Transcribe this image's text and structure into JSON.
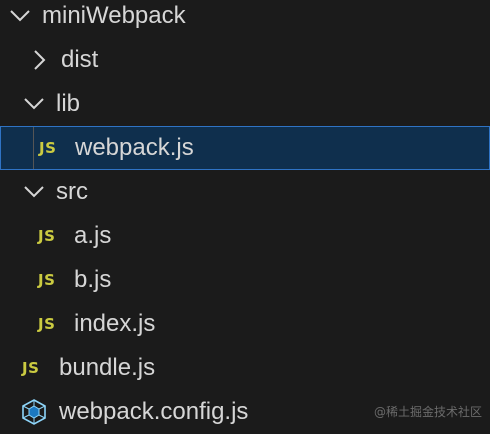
{
  "explorer": {
    "root": {
      "label": "miniWebpack",
      "expanded": true
    },
    "items": [
      {
        "label": "dist",
        "type": "folder",
        "expanded": false
      },
      {
        "label": "lib",
        "type": "folder",
        "expanded": true
      },
      {
        "label": "webpack.js",
        "type": "js",
        "selected": true,
        "icon_text": "JS"
      },
      {
        "label": "src",
        "type": "folder",
        "expanded": true
      },
      {
        "label": "a.js",
        "type": "js",
        "icon_text": "JS"
      },
      {
        "label": "b.js",
        "type": "js",
        "icon_text": "JS"
      },
      {
        "label": "index.js",
        "type": "js",
        "icon_text": "JS"
      },
      {
        "label": "bundle.js",
        "type": "js",
        "icon_text": "JS"
      },
      {
        "label": "webpack.config.js",
        "type": "webpack-config"
      }
    ]
  },
  "watermark": "@稀土掘金技术社区",
  "colors": {
    "background": "#1b1b1b",
    "selected_background": "#0f2f4d",
    "selected_border": "#2f73c4",
    "js_icon": "#cbcb41",
    "webpack_icon": "#8ed6fb",
    "text": "#d6d6d6"
  }
}
